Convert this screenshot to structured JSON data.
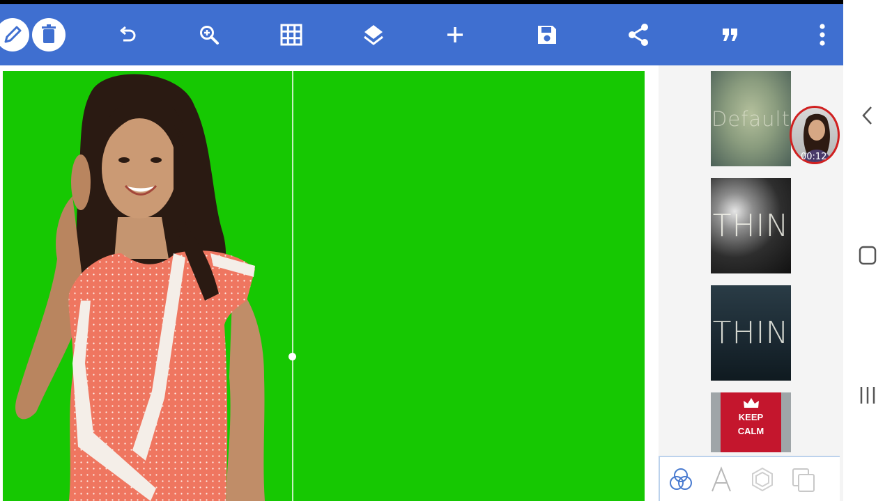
{
  "toolbar": {
    "icons": [
      "pencil-icon",
      "trash-icon",
      "undo-icon",
      "zoom-icon",
      "grid-icon",
      "layers-icon",
      "plus-icon",
      "save-icon",
      "share-icon",
      "quote-icon",
      "more-icon"
    ],
    "color": "#3f6fd0"
  },
  "canvas": {
    "background_color": "#16c802"
  },
  "template_panel": {
    "thumbnails": [
      {
        "label": "Default"
      },
      {
        "label": "THIN"
      },
      {
        "label": "THIN"
      },
      {
        "label_lines": [
          "KEEP",
          "CALM"
        ]
      }
    ]
  },
  "floating_bubble": {
    "timer": "00:12",
    "ring_color": "#d02020"
  },
  "bottom_tools": {
    "icons": [
      "color-circles-icon",
      "text-icon",
      "hexagon-icon",
      "layers-copy-icon"
    ]
  },
  "system_nav": {
    "icons": [
      "back-icon",
      "home-icon",
      "recents-icon"
    ]
  }
}
